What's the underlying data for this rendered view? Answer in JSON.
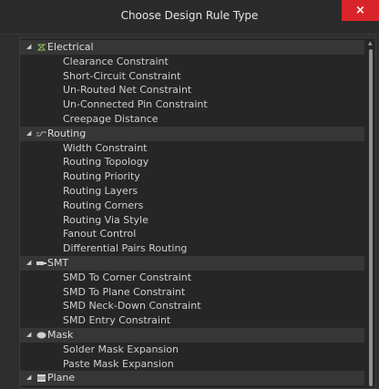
{
  "dialog": {
    "title": "Choose Design Rule Type",
    "close_label": "×"
  },
  "categories": [
    {
      "label": "Electrical",
      "icon": "electrical-icon",
      "items": [
        "Clearance Constraint",
        "Short-Circuit Constraint",
        "Un-Routed Net Constraint",
        "Un-Connected Pin Constraint",
        "Creepage Distance"
      ]
    },
    {
      "label": "Routing",
      "icon": "routing-icon",
      "items": [
        "Width Constraint",
        "Routing Topology",
        "Routing Priority",
        "Routing Layers",
        "Routing Corners",
        "Routing Via Style",
        "Fanout Control",
        "Differential Pairs Routing"
      ]
    },
    {
      "label": "SMT",
      "icon": "smt-icon",
      "items": [
        "SMD To Corner Constraint",
        "SMD To Plane Constraint",
        "SMD Neck-Down Constraint",
        "SMD Entry Constraint"
      ]
    },
    {
      "label": "Mask",
      "icon": "mask-icon",
      "items": [
        "Solder Mask Expansion",
        "Paste Mask Expansion"
      ]
    },
    {
      "label": "Plane",
      "icon": "plane-icon",
      "items": []
    }
  ]
}
